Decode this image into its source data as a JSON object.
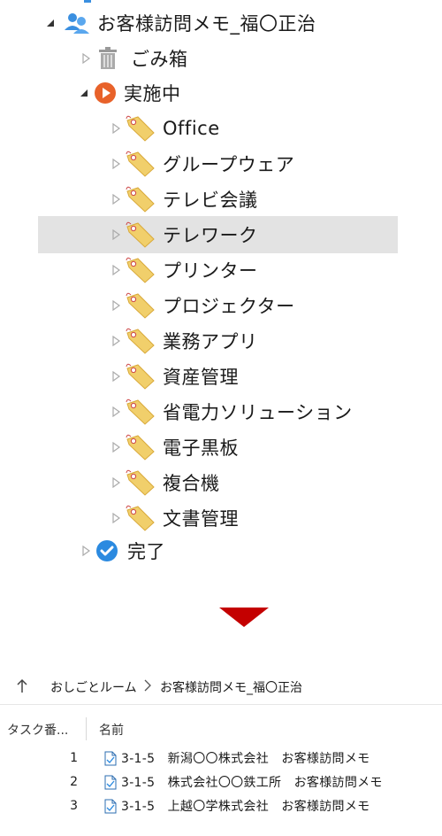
{
  "tree": {
    "root": {
      "label": "お客様訪問メモ_福〇正治"
    },
    "trash": {
      "label": "ごみ箱"
    },
    "in_progress": {
      "label": "実施中"
    },
    "tags": [
      {
        "label": "Office"
      },
      {
        "label": "グループウェア"
      },
      {
        "label": "テレビ会議"
      },
      {
        "label": "テレワーク"
      },
      {
        "label": "プリンター"
      },
      {
        "label": "プロジェクター"
      },
      {
        "label": "業務アプリ"
      },
      {
        "label": "資産管理"
      },
      {
        "label": "省電力ソリューション"
      },
      {
        "label": "電子黒板"
      },
      {
        "label": "複合機"
      },
      {
        "label": "文書管理"
      }
    ],
    "done": {
      "label": "完了"
    },
    "selected_tag": "テレワーク"
  },
  "colors": {
    "arrow": "#c40000",
    "in_progress_icon": "#e8622a",
    "done_icon": "#2b8ae0",
    "tag": "#f1cf6b"
  },
  "breadcrumb": {
    "up_icon": "up-arrow-icon",
    "parts": [
      "おしごとルーム",
      "お客様訪問メモ_福〇正治"
    ]
  },
  "list": {
    "columns": [
      "タスク番...",
      "名前"
    ],
    "rows": [
      {
        "num": "1",
        "name": "3-1-5　新潟〇〇株式会社　お客様訪問メモ"
      },
      {
        "num": "2",
        "name": "3-1-5　株式会社〇〇鉄工所　お客様訪問メモ"
      },
      {
        "num": "3",
        "name": "3-1-5　上越〇学株式会社　お客様訪問メモ"
      }
    ]
  }
}
